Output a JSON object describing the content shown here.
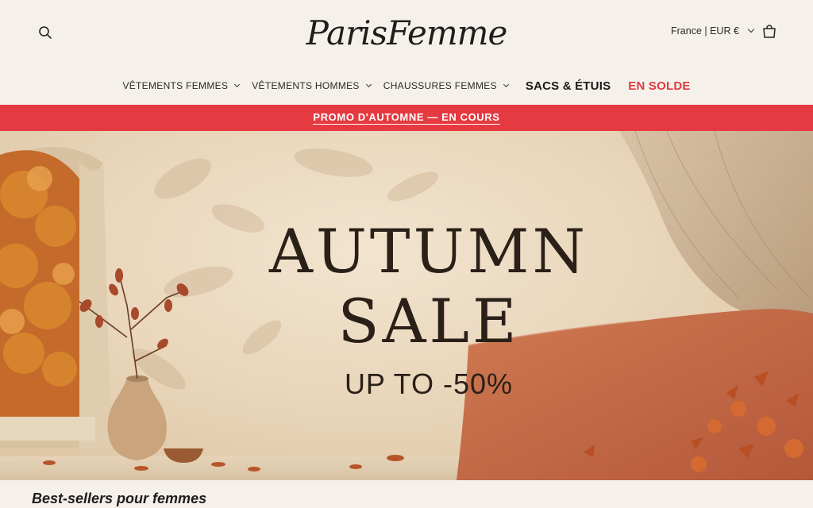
{
  "header": {
    "logo_text": "ParisFemme",
    "locale_label": "France | EUR €",
    "search_icon": "search-icon",
    "cart_icon": "cart-icon"
  },
  "nav": {
    "items": [
      {
        "label": "VÊTEMENTS FEMMES",
        "has_dropdown": true
      },
      {
        "label": "VÊTEMENTS HOMMES",
        "has_dropdown": true
      },
      {
        "label": "CHAUSSURES FEMMES",
        "has_dropdown": true
      },
      {
        "label": "SACS & ÉTUIS",
        "has_dropdown": false
      },
      {
        "label": "EN SOLDE",
        "has_dropdown": false
      }
    ]
  },
  "promo": {
    "text": "PROMO D'AUTOMNE — EN COURS",
    "color": "#e63a42"
  },
  "hero": {
    "title_line1": "AUTUMN",
    "title_line2": "SALE",
    "subtitle": "UP TO -50%"
  },
  "section": {
    "title": "Best-sellers pour femmes"
  },
  "colors": {
    "background": "#f5f1ea",
    "accent": "#e63a42",
    "sale_link": "#e03a3e"
  }
}
